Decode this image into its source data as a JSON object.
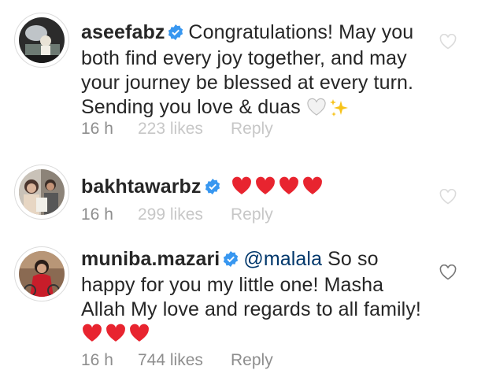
{
  "comments": [
    {
      "username": "aseefabz",
      "text_lines": [
        "Congratulations! May you",
        "both find every joy together, and may",
        "your journey be blessed at every turn.",
        "Sending you love & duas"
      ],
      "time": "16 h",
      "likes": "223 likes",
      "reply": "Reply",
      "emoji": [
        "white-heart",
        "sparkles"
      ]
    },
    {
      "username": "bakhtawarbz",
      "time": "16 h",
      "likes": "299 likes",
      "reply": "Reply",
      "emoji": [
        "red-heart",
        "red-heart",
        "red-heart",
        "red-heart"
      ]
    },
    {
      "username": "muniba.mazari",
      "mention": "@malala",
      "text_lines": [
        "So so",
        "happy for you my little one! Masha",
        "Allah  My love and regards to all family!"
      ],
      "time": "16 h",
      "likes": "744 likes",
      "reply": "Reply",
      "emoji": [
        "red-heart",
        "red-heart",
        "red-heart"
      ]
    }
  ],
  "colors": {
    "username": "#262626",
    "meta": "#8e8e8e",
    "mention": "#00376b",
    "verified": "#3897f0",
    "heart": "#e8242f"
  }
}
